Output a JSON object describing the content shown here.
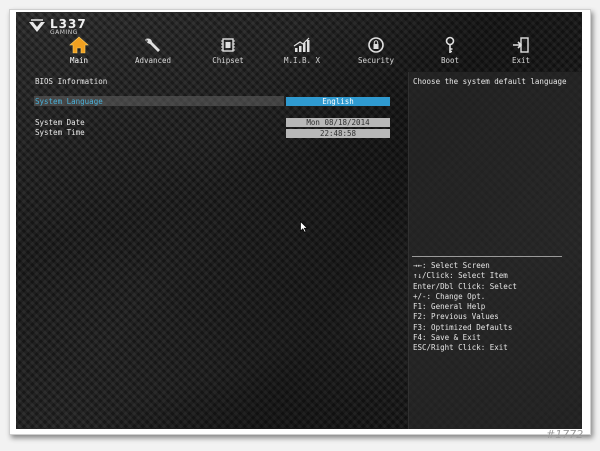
{
  "logo": {
    "brand": "L337",
    "subtitle": "GAMING"
  },
  "tabs": [
    {
      "label": "Main",
      "icon": "home-icon",
      "active": true
    },
    {
      "label": "Advanced",
      "icon": "wrench-icon",
      "active": false
    },
    {
      "label": "Chipset",
      "icon": "chip-icon",
      "active": false
    },
    {
      "label": "M.I.B. X",
      "icon": "performance-meter-icon",
      "active": false
    },
    {
      "label": "Security",
      "icon": "security-icon",
      "active": false
    },
    {
      "label": "Boot",
      "icon": "key-icon",
      "active": false
    },
    {
      "label": "Exit",
      "icon": "exit-door-icon",
      "active": false
    }
  ],
  "main": {
    "section_title": "BIOS Information",
    "language": {
      "label": "System Language",
      "value": "English"
    },
    "date": {
      "label": "System Date",
      "value": "Mon 08/18/2014"
    },
    "time": {
      "label": "System Time",
      "value": "22:48:58"
    }
  },
  "help": {
    "description": "Choose the system default language",
    "keys": [
      "→←: Select Screen",
      "↑↓/Click: Select Item",
      "Enter/Dbl Click: Select",
      "+/-: Change Opt.",
      "F1: General Help",
      "F2: Previous Values",
      "F3: Optimized Defaults",
      "F4: Save & Exit",
      "ESC/Right Click: Exit"
    ]
  },
  "watermark": "#1772",
  "colors": {
    "accent": "#2f9ad0",
    "highlight_text": "#4ab0d8",
    "field_grey": "#b8b8b8"
  }
}
